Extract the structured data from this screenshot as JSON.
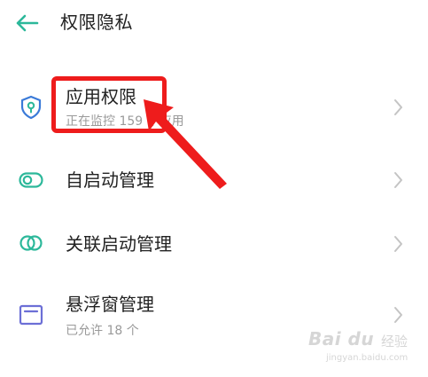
{
  "header": {
    "title": "权限隐私",
    "back_icon": "back-arrow-icon"
  },
  "colors": {
    "accent": "#2cb89a",
    "icon_blue": "#3a7ad8",
    "icon_purple": "#6c6fd6",
    "annotation_red": "#ee1c1c",
    "secondary_text": "#9a9a9a",
    "chevron": "#c4c4c4"
  },
  "items": [
    {
      "icon": "shield-location-icon",
      "label": "应用权限",
      "subtitle": "正在监控 159 个应用"
    },
    {
      "icon": "toggle-icon",
      "label": "自启动管理"
    },
    {
      "icon": "link-rings-icon",
      "label": "关联启动管理"
    },
    {
      "icon": "floating-window-icon",
      "label": "悬浮窗管理",
      "subtitle": "已允许 18 个"
    }
  ],
  "watermark": {
    "brand": "Bai du",
    "brand_zh": "经验",
    "url": "jingyan.baidu.com"
  }
}
